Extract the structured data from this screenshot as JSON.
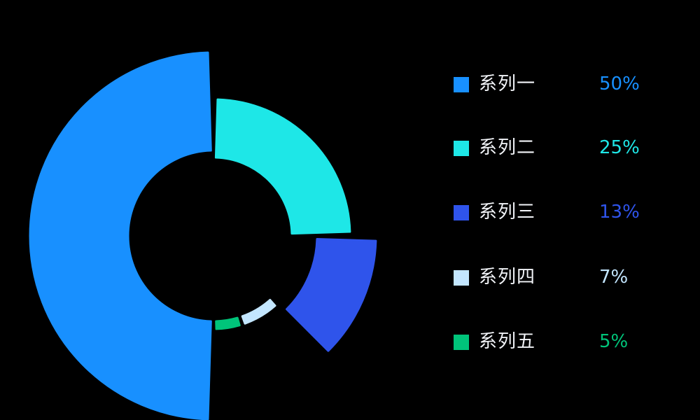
{
  "chart_data": {
    "type": "pie",
    "variant": "rose-donut",
    "series": [
      {
        "name": "系列一",
        "value": 50,
        "label": "50%",
        "color": "#1890ff"
      },
      {
        "name": "系列二",
        "value": 25,
        "label": "25%",
        "color": "#1ee7e7"
      },
      {
        "name": "系列三",
        "value": 13,
        "label": "13%",
        "color": "#2f54eb"
      },
      {
        "name": "系列四",
        "value": 7,
        "label": "7%",
        "color": "#c3e6ff"
      },
      {
        "name": "系列五",
        "value": 5,
        "label": "5%",
        "color": "#00c47a"
      }
    ],
    "legend": "right"
  }
}
